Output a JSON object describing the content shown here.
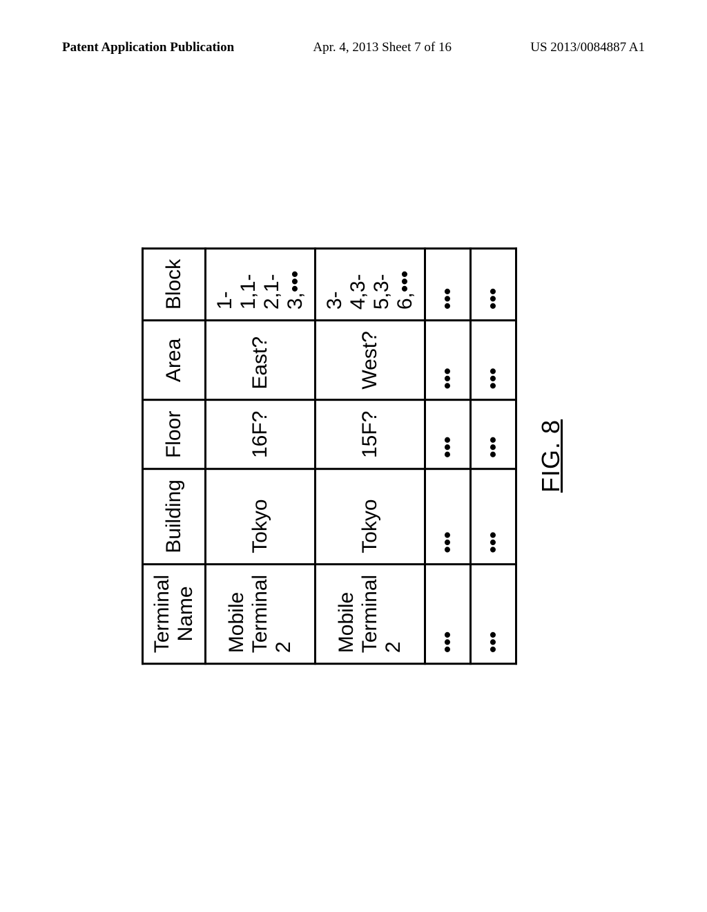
{
  "header": {
    "left": "Patent Application Publication",
    "center": "Apr. 4, 2013  Sheet 7 of 16",
    "right": "US 2013/0084887 A1"
  },
  "table": {
    "headers": {
      "terminal": "Terminal Name",
      "building": "Building",
      "floor": "Floor",
      "area": "Area",
      "block": "Block"
    },
    "rows": [
      {
        "terminal": "Mobile Terminal 2",
        "building": "Tokyo",
        "floor": "16F?",
        "area": "East?",
        "block": "1-1,1-2,1-3,•••"
      },
      {
        "terminal": "Mobile Terminal 2",
        "building": "Tokyo",
        "floor": "15F?",
        "area": "West?",
        "block": "3-4,3-5,3-6,•••"
      },
      {
        "terminal": "•••",
        "building": "•••",
        "floor": "•••",
        "area": "•••",
        "block": "•••"
      },
      {
        "terminal": "•••",
        "building": "•••",
        "floor": "•••",
        "area": "•••",
        "block": "•••"
      }
    ]
  },
  "caption": "FIG. 8"
}
